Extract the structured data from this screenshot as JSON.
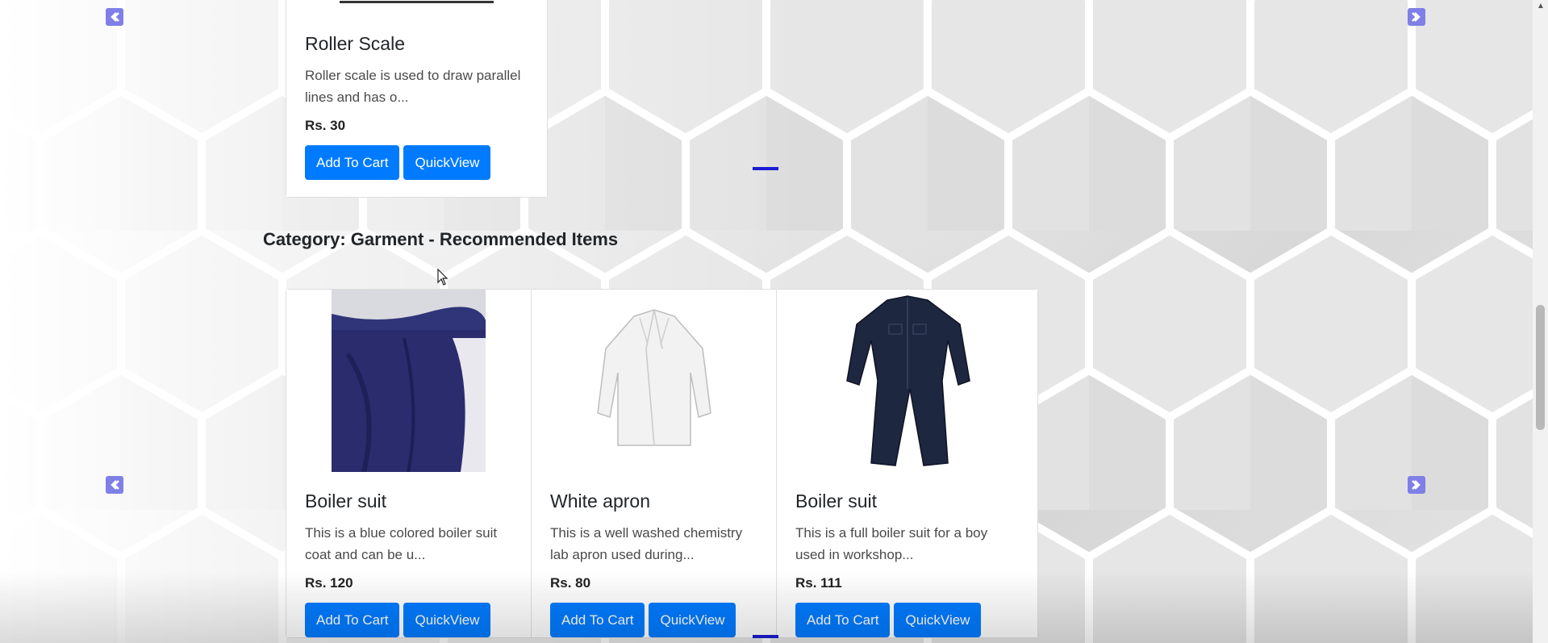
{
  "top_card": {
    "title": "Roller Scale",
    "description": "Roller scale is used to draw parallel lines and has o...",
    "price": "Rs. 30",
    "add_to_cart": "Add To Cart",
    "quickview": "QuickView"
  },
  "category": {
    "title": "Category: Garment - Recommended Items"
  },
  "garment_cards": [
    {
      "title": "Boiler suit",
      "description": "This is a blue colored boiler suit coat and can be u...",
      "price": "Rs. 120",
      "add_to_cart": "Add To Cart",
      "quickview": "QuickView",
      "image": "blue-boiler-suit-photo"
    },
    {
      "title": "White apron",
      "description": "This is a well washed chemistry lab apron used during...",
      "price": "Rs. 80",
      "add_to_cart": "Add To Cart",
      "quickview": "QuickView",
      "image": "white-lab-apron-photo"
    },
    {
      "title": "Boiler suit",
      "description": "This is a full boiler suit for a boy used in workshop...",
      "price": "Rs. 111",
      "add_to_cart": "Add To Cart",
      "quickview": "QuickView",
      "image": "navy-coverall-photo"
    }
  ],
  "carousel": {
    "prev_icon": "chevron-left-icon",
    "next_icon": "chevron-right-icon"
  },
  "colors": {
    "button": "#007bff",
    "arrow": "#7f7fe8",
    "indicator": "#1b1bd3"
  }
}
